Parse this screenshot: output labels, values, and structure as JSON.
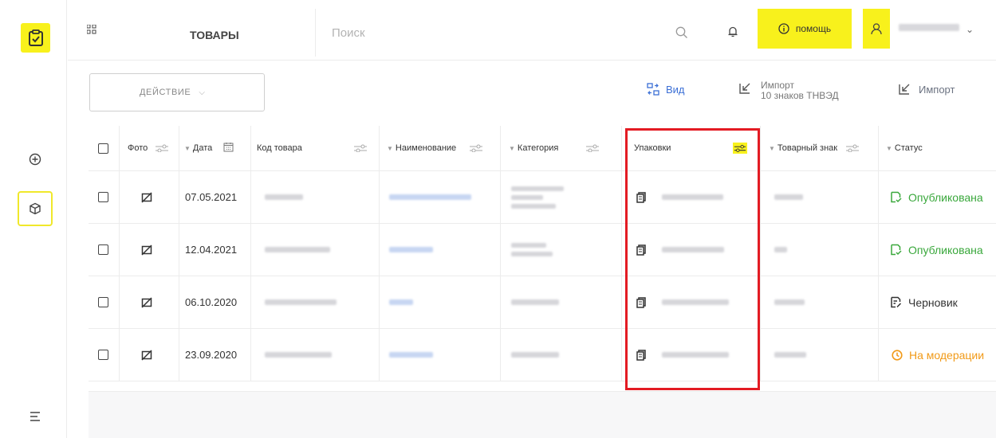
{
  "rail": {
    "logo_icon": "checkbox-doc-icon",
    "items": [
      {
        "icon": "add-circle-icon",
        "active": false
      },
      {
        "icon": "box-icon",
        "active": true
      }
    ],
    "menu_icon": "hamburger-icon"
  },
  "header": {
    "title": "ТОВАРЫ",
    "search_placeholder": "Поиск",
    "help_label": "помощь",
    "user_name": "•••••• •••• •••",
    "accent": "#f8f11c"
  },
  "toolbar": {
    "action_label": "ДЕЙСТВИЕ",
    "view_label": "Вид",
    "import_tnved_label_1": "Импорт",
    "import_tnved_label_2": "10 знаков ТНВЭД",
    "import_label": "Импорт"
  },
  "table": {
    "columns": {
      "photo": "Фото",
      "date": "Дата",
      "code": "Код товара",
      "name": "Наименование",
      "category": "Категория",
      "packaging": "Упаковки",
      "trademark": "Товарный знак",
      "status": "Статус"
    },
    "rows": [
      {
        "date": "07.05.2021",
        "code": "••••••••",
        "name": "•••• •••••••• ••••",
        "category": "••••• • •••••••••• ••••••• ••••••••••••",
        "packaging": "••••••••••••••",
        "trademark": "•••••••",
        "status": "Опубликована",
        "status_type": "published"
      },
      {
        "date": "12.04.2021",
        "code": "••••••••••••••",
        "name": "••••••• •••",
        "category": "••••••••• •••••••••",
        "packaging": "••••••••••••",
        "trademark": "•••",
        "status": "Опубликована",
        "status_type": "published"
      },
      {
        "date": "06.10.2020",
        "code": "••••••••••••••••",
        "name": "•••• •",
        "category": "••••••••••",
        "packaging": "••••••••••••••",
        "trademark": "•••••••",
        "status": "Черновик",
        "status_type": "draft"
      },
      {
        "date": "23.09.2020",
        "code": "••••••••••••••••",
        "name": "•••••• •••",
        "category": "••••••••••",
        "packaging": "••••••••••••••",
        "trademark": "•••••••",
        "status": "На модерации",
        "status_type": "moderation"
      }
    ]
  },
  "colors": {
    "published": "#3aa83c",
    "draft": "#333333",
    "moderation": "#f19a18",
    "highlight_frame": "#e31b23"
  }
}
